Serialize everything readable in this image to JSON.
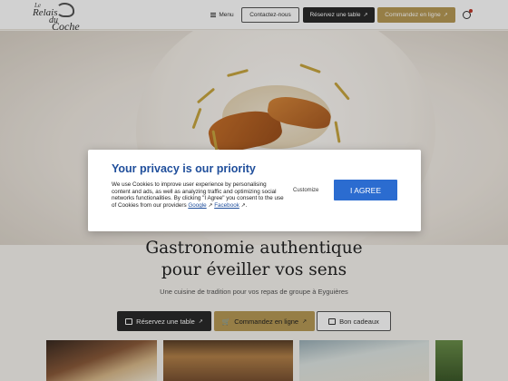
{
  "header": {
    "logo": {
      "line1": "Le",
      "line2": "Relais",
      "line3": "du",
      "line4": "Coche"
    },
    "menu_label": "Menu",
    "contact_label": "Contactez-nous",
    "reserve_label": "Réservez une table",
    "order_label": "Commandez en ligne"
  },
  "hero": {
    "headline_line1": "Gastronomie authentique",
    "headline_line2": "pour éveiller vos sens",
    "subtitle": "Une cuisine de tradition pour vos repas de groupe à Eyguières"
  },
  "actions": {
    "reserve_label": "Réservez une table",
    "order_label": "Commandez en ligne",
    "gift_label": "Bon cadeaux"
  },
  "privacy": {
    "title": "Your privacy is our priority",
    "text": "We use Cookies to improve user experience by personalising content and ads, as well as analyzing traffic and optimizing social networks functionalities. By clicking \"I Agree\" you consent to the use of Cookies from our providers",
    "link_google": "Google",
    "link_facebook": "Facebook",
    "customize_label": "Customize",
    "agree_label": "I AGREE"
  },
  "colors": {
    "accent_gold": "#b89a56",
    "dark_button": "#2a2a2a",
    "privacy_blue": "#1f4e9b",
    "agree_blue": "#2b6cd0",
    "notification_dot": "#c0392b"
  },
  "icons": [
    "menu-icon",
    "external-link-icon",
    "user-icon",
    "calendar-icon",
    "cart-icon",
    "gift-icon"
  ]
}
